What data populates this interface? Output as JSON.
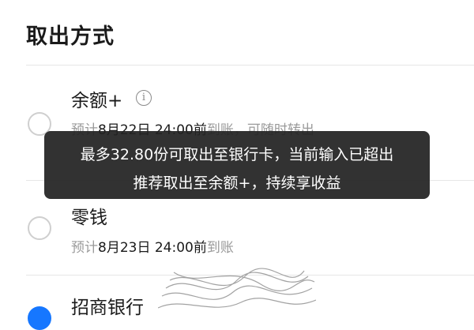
{
  "section_title": "取出方式",
  "options": [
    {
      "name": "余额+",
      "desc_prefix": "预计",
      "desc_time": "8月22日 24:00前",
      "desc_suffix": "到账，可随时转出",
      "selected": false
    },
    {
      "name": "零钱",
      "desc_prefix": "预计",
      "desc_time": "8月23日 24:00前",
      "desc_suffix": "到账",
      "selected": false
    },
    {
      "name": "招商银行",
      "selected": true
    }
  ],
  "tooltip": {
    "line1": "最多32.80份可取出至银行卡，当前输入已超出",
    "line2": "推荐取出至余额+，持续享收益"
  },
  "info_icon_glyph": "i",
  "colors": {
    "accent": "#1677ff",
    "tooltip_bg": "#222222",
    "muted_text": "#9a9a9a"
  }
}
